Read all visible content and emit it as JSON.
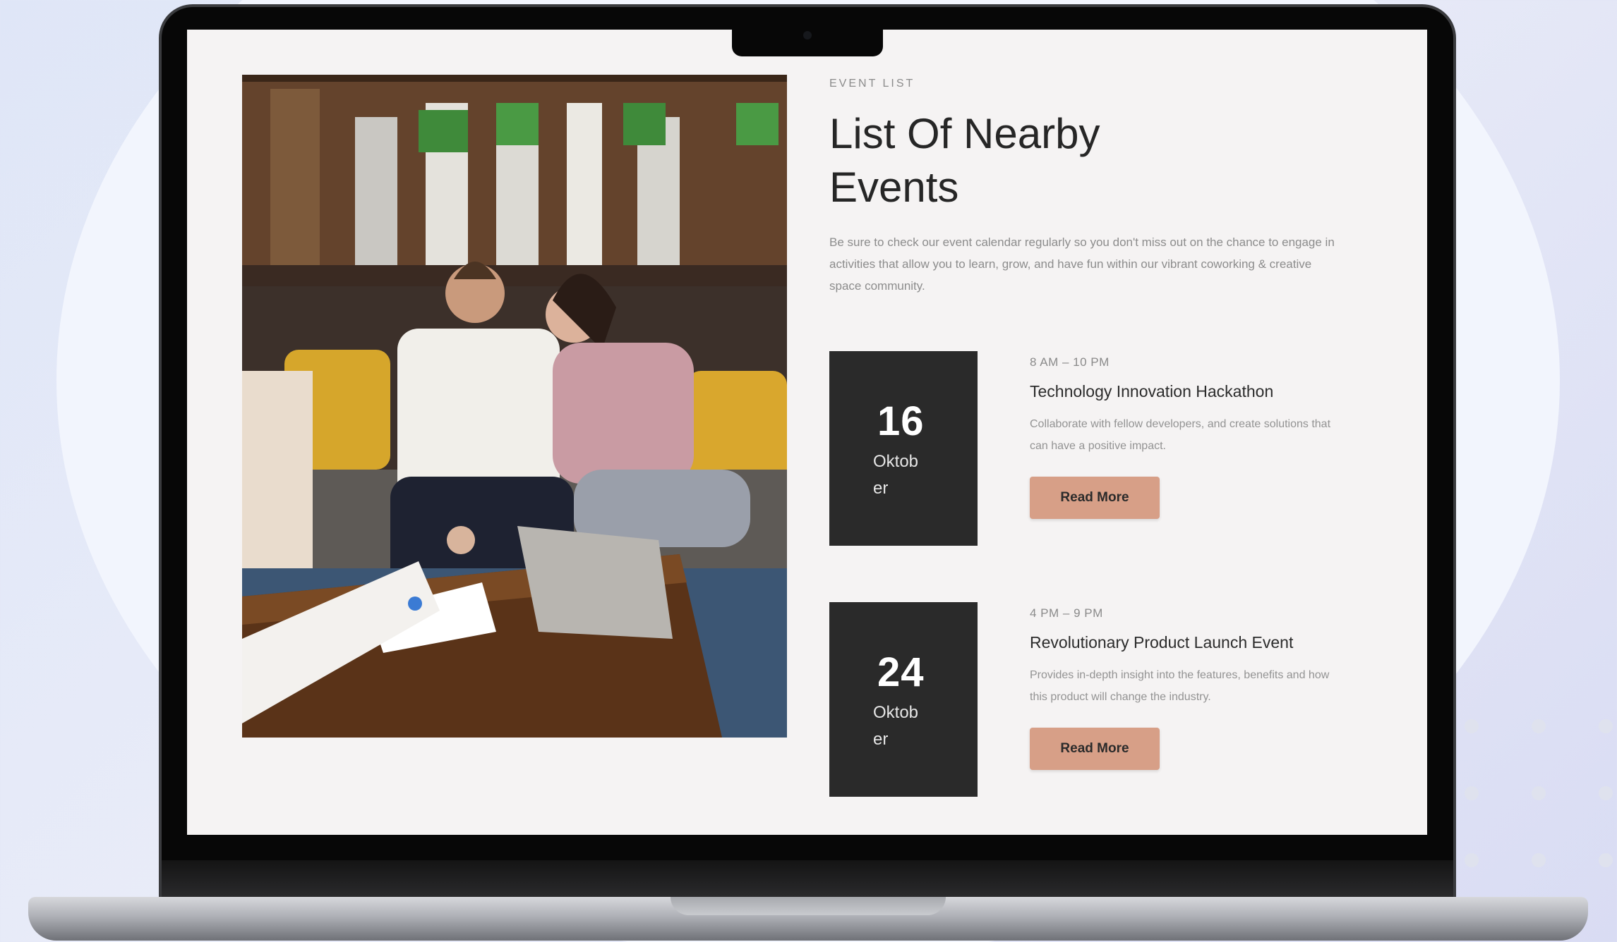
{
  "section": {
    "eyebrow": "EVENT LIST",
    "title": "List Of Nearby Events",
    "intro": "Be sure to check our event calendar regularly so you don't miss out on the chance to engage in activities that allow you to learn, grow, and have fun within our vibrant coworking & creative space community."
  },
  "events": [
    {
      "day": "16",
      "month": "Oktober",
      "time": "8 AM – 10 PM",
      "title": "Technology Innovation Hackathon",
      "description": "Collaborate with fellow developers, and create solutions that can have a positive impact.",
      "button_label": "Read More"
    },
    {
      "day": "24",
      "month": "Oktober",
      "time": "4 PM – 9 PM",
      "title": "Revolutionary Product Launch Event",
      "description": "Provides in-depth insight into the features, benefits and how this product will change the industry.",
      "button_label": "Read More"
    }
  ],
  "colors": {
    "date_box": "#2a2a2a",
    "button": "#d79f87",
    "screen_bg": "#f5f3f3",
    "title": "#262626"
  }
}
